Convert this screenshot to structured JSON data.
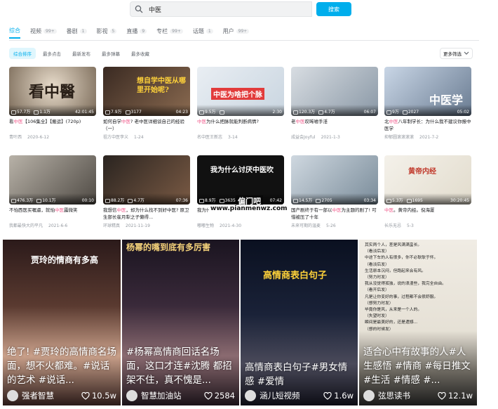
{
  "search": {
    "value": "中医",
    "button": "搜索"
  },
  "tabs": [
    {
      "label": "综合",
      "count": ""
    },
    {
      "label": "视频",
      "count": "99+"
    },
    {
      "label": "番剧",
      "count": "1"
    },
    {
      "label": "影视",
      "count": "5"
    },
    {
      "label": "直播",
      "count": "9"
    },
    {
      "label": "专栏",
      "count": "99+"
    },
    {
      "label": "话题",
      "count": "1"
    },
    {
      "label": "用户",
      "count": "99+"
    }
  ],
  "filters": [
    "综合排序",
    "最多点击",
    "最新发布",
    "最多弹幕",
    "最多收藏"
  ],
  "more_filters": "更多筛选",
  "videos": [
    {
      "plays": "57.7万",
      "danmaku": "1.1万",
      "duration": "42:01:45",
      "title_pre": "看",
      "title_hl": "中医",
      "title_post": "【106集全】【搬运】(720p)",
      "author": "青叶西",
      "date": "2020-6-12",
      "thumb_text": "看中醫"
    },
    {
      "plays": "7.9万",
      "danmaku": "3177",
      "duration": "04:23",
      "title_pre": "如何自学",
      "title_hl": "中医",
      "title_post": "? 老中医详细谈自己的经验（一）",
      "author": "祖方中医李义",
      "date": "1-24",
      "thumb_text": "想自学中医从哪里开始呢?"
    },
    {
      "plays": "9.5万",
      "danmaku": "",
      "duration": "2:30",
      "title_pre": "",
      "title_hl": "中医",
      "title_post": "为什么把脉就能判断病情?",
      "author": "名中医王新志",
      "date": "3-14",
      "thumb_text": "中医为啥把个脉"
    },
    {
      "plays": "120.3万",
      "danmaku": "4.7万",
      "duration": "06:07",
      "title_pre": "老",
      "title_hl": "中医",
      "title_post": "叹唏嘘手淫",
      "author": "成益会Joyful",
      "date": "2021-1-3",
      "thumb_text": ""
    },
    {
      "plays": "9万",
      "danmaku": "2027",
      "duration": "05:02",
      "title_pre": "北",
      "title_hl": "中医",
      "title_post": "八年制学长：为什么我不建议你报中医学",
      "author": "抑郁圆滚滚滚滚",
      "date": "2021-7-2",
      "thumb_text": "中医学"
    },
    {
      "plays": "476.3万",
      "danmaku": "10.1万",
      "duration": "00:10",
      "title_pre": "不怕西医买嘱逼，就怕",
      "title_hl": "中医",
      "title_post": "露微笑",
      "author": "我都最快大的平凡",
      "date": "2021-6-6",
      "thumb_text": ""
    },
    {
      "plays": "88.2万",
      "danmaku": "4.7万",
      "duration": "07:36",
      "title_pre": "我想信",
      "title_hl": "中医",
      "title_post": "，却为什么找不到好中医? 原卫生部长崔月犁之子懒得...",
      "author": "环球精真",
      "date": "2021-11-19",
      "thumb_text": ""
    },
    {
      "plays": "8.9万",
      "danmaku": "3635",
      "duration": "07:42",
      "title_pre": "我为什么讨厌",
      "title_hl": "中医",
      "title_post": "吹",
      "author": "嘟嘟生物",
      "date": "2021-4-30",
      "thumb_text": "我为什么讨厌中医吹"
    },
    {
      "plays": "14.5万",
      "danmaku": "2705",
      "duration": "03:34",
      "title_pre": "国产剧终于有一部以",
      "title_hl": "中医",
      "title_post": "为主题的剧了! 可惜被压了十年",
      "author": "未来可期的温麦",
      "date": "5-26",
      "thumb_text": ""
    },
    {
      "plays": "5.3万",
      "danmaku": "1695",
      "duration": "30:20:45",
      "title_pre": "",
      "title_hl": "中医",
      "title_post": "。黄帝内经。倪海厦",
      "author": "长乐无忌",
      "date": "5-3",
      "thumb_text": "黄帝内经"
    }
  ],
  "watermark": {
    "cn": "偏门吧",
    "url": "www.pianmenwz.com"
  },
  "big_cards": [
    {
      "header": "贾玲的情商有多高",
      "caption": "绝了! #贾玲的高情商名场面，想不火都难。#说话的艺术 #说话...",
      "author": "强者智慧",
      "likes": "10.5w"
    },
    {
      "header": "杨幂的嘴到底有多厉害",
      "caption": "#杨幂高情商回话名场面，这口才连#沈腾 都招架不住，真不愧是...",
      "author": "智慧加油站",
      "likes": "2584"
    },
    {
      "header": "高情商表白句子",
      "caption": "高情商表白句子#男女情感 #爱情",
      "author": "涵儿短视频",
      "likes": "1.6w"
    },
    {
      "header": "",
      "caption": "适合心中有故事的人#人生感悟 #情商 #每日推文 #生活 #情感 #...",
      "author": "弦思读书",
      "likes": "12.1w"
    }
  ],
  "poem_lines": [
    "其实两个人，差是风满满蛮长。",
    "（看淡后发）",
    "中途下车的人有很多，你不必耿耿于怀。",
    "（看淡后发）",
    "生活原本沉闷，但跑起来会有风。",
    "（努力时发）",
    "我从没觉得孤独，说的浪漫些，我完全自由。",
    "（看开后发）",
    "凡是让你变好的事，过程都不会很舒服。",
    "（想努力时发）",
    "毕竟你是风，从来是一个人的。",
    "（失望时发）",
    "瞬间是最美好的，还是遗憾...",
    "（想的时候发）"
  ]
}
